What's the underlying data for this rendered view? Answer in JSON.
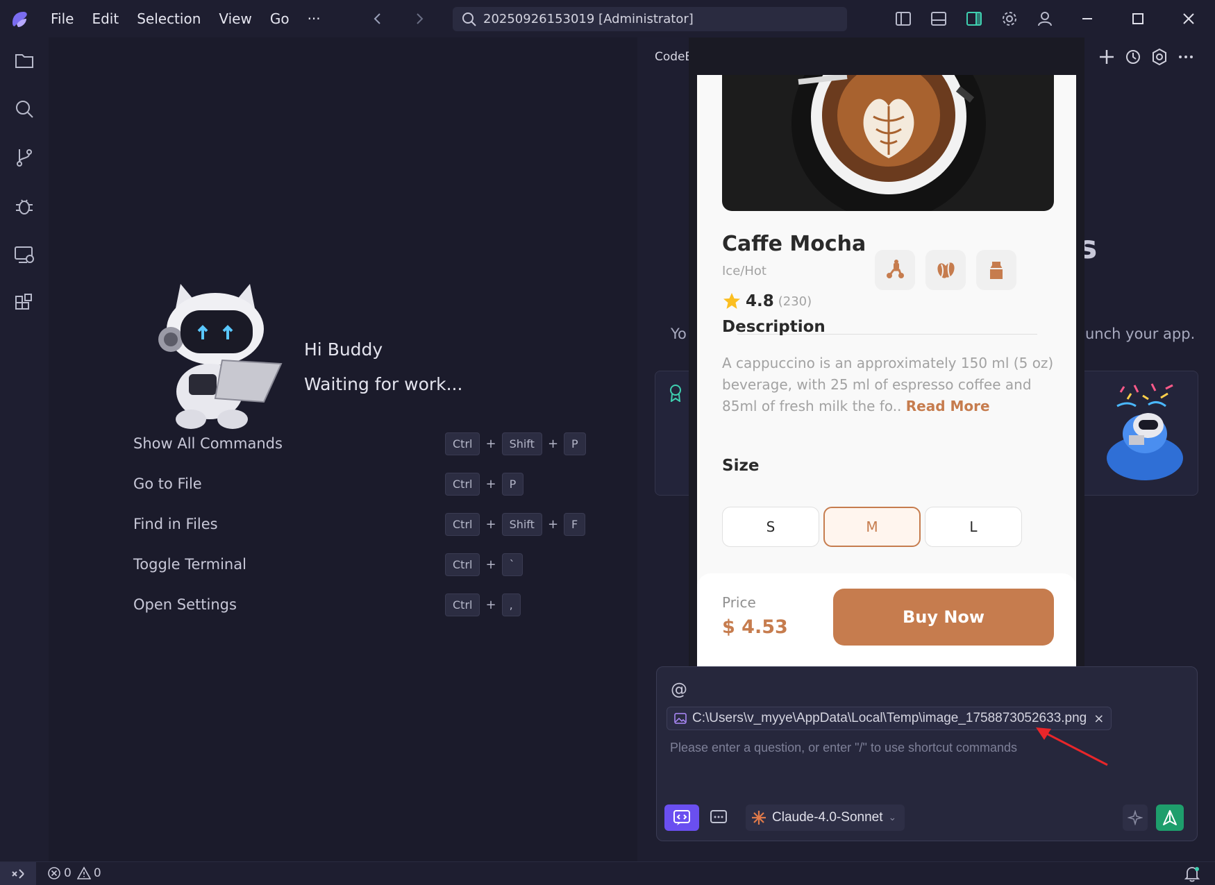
{
  "titlebar": {
    "menu": [
      "File",
      "Edit",
      "Selection",
      "View",
      "Go",
      "···"
    ],
    "search_text": "20250926153019 [Administrator]"
  },
  "welcome": {
    "greeting": "Hi Buddy",
    "status": "Waiting for work...",
    "commands": [
      {
        "label": "Show All Commands",
        "keys": [
          "Ctrl",
          "Shift",
          "P"
        ]
      },
      {
        "label": "Go to File",
        "keys": [
          "Ctrl",
          "P"
        ]
      },
      {
        "label": "Find in Files",
        "keys": [
          "Ctrl",
          "Shift",
          "F"
        ]
      },
      {
        "label": "Toggle Terminal",
        "keys": [
          "Ctrl",
          "`"
        ]
      },
      {
        "label": "Open Settings",
        "keys": [
          "Ctrl",
          ","
        ]
      }
    ],
    "plus": "+"
  },
  "panel": {
    "title": "CodeBuddy",
    "bg_left_text": "Yo",
    "bg_right_text": "unch your app.",
    "bg_big_letter": "s"
  },
  "preview": {
    "product_name": "Caffe Mocha",
    "variant": "Ice/Hot",
    "rating": "4.8",
    "rating_count": "(230)",
    "description_heading": "Description",
    "description": "A cappuccino is an approximately 150 ml (5 oz) beverage, with 25 ml of espresso coffee and 85ml of fresh milk the fo..",
    "read_more": "Read More",
    "size_heading": "Size",
    "sizes": [
      "S",
      "M",
      "L"
    ],
    "selected_size": "M",
    "price_label": "Price",
    "price": "$ 4.53",
    "buy_label": "Buy Now",
    "accent_color": "#c67c4e"
  },
  "chat": {
    "at_symbol": "@",
    "attachment": "C:\\Users\\v_myye\\AppData\\Local\\Temp\\image_1758873052633.png",
    "remove_symbol": "×",
    "placeholder": "Please enter a question, or enter \"/\" to use shortcut commands",
    "model": "Claude-4.0-Sonnet"
  },
  "statusbar": {
    "errors": "0",
    "warnings": "0"
  }
}
